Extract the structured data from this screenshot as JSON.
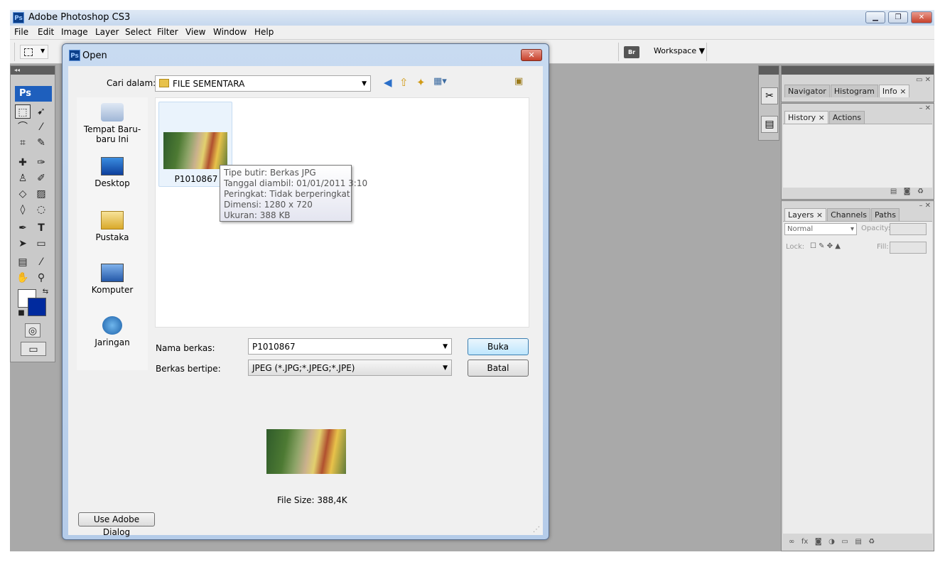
{
  "app": {
    "title": "Adobe Photoshop CS3",
    "logo": "Ps",
    "window_buttons": [
      "minimize",
      "maximize",
      "close"
    ]
  },
  "menu": [
    "File",
    "Edit",
    "Image",
    "Layer",
    "Select",
    "Filter",
    "View",
    "Window",
    "Help"
  ],
  "options_bar": {
    "bridge_label": "Br",
    "workspace_label": "Workspace ▼"
  },
  "tools_panel": {
    "collapse": "◂◂",
    "logo": "Ps"
  },
  "right_panels": {
    "expand": "▸▸",
    "group1_tabs": [
      "Navigator",
      "Histogram",
      "Info ×"
    ],
    "group2_tabs": [
      "History ×",
      "Actions"
    ],
    "group3_tabs": [
      "Layers ×",
      "Channels",
      "Paths"
    ],
    "blend_mode": "Normal",
    "opacity_label": "Opacity:",
    "lock_label": "Lock:",
    "fill_label": "Fill:"
  },
  "dialog": {
    "title": "Open",
    "logo": "Ps",
    "close": "✕",
    "look_in_label": "Cari dalam:",
    "look_in_value": "FILE SEMENTARA",
    "places": [
      "Tempat Baru-baru Ini",
      "Desktop",
      "Pustaka",
      "Komputer",
      "Jaringan"
    ],
    "file": {
      "name": "P1010867"
    },
    "tooltip": [
      "Tipe butir: Berkas JPG",
      "Tanggal diambil: 01/01/2011 3:10",
      "Peringkat: Tidak berperingkat",
      "Dimensi: 1280 x 720",
      "Ukuran: 388 KB"
    ],
    "filename_label": "Nama berkas:",
    "filename_value": "P1010867",
    "filetype_label": "Berkas bertipe:",
    "filetype_value": "JPEG (*.JPG;*.JPEG;*.JPE)",
    "open_button": "Buka",
    "cancel_button": "Batal",
    "file_size": "File Size: 388,4K",
    "adobe_dialog_button": "Use Adobe Dialog"
  },
  "colors": {
    "ps_blue": "#1e5fbd",
    "background_swatch": "#002a9e",
    "foreground_swatch": "#ffffff"
  }
}
